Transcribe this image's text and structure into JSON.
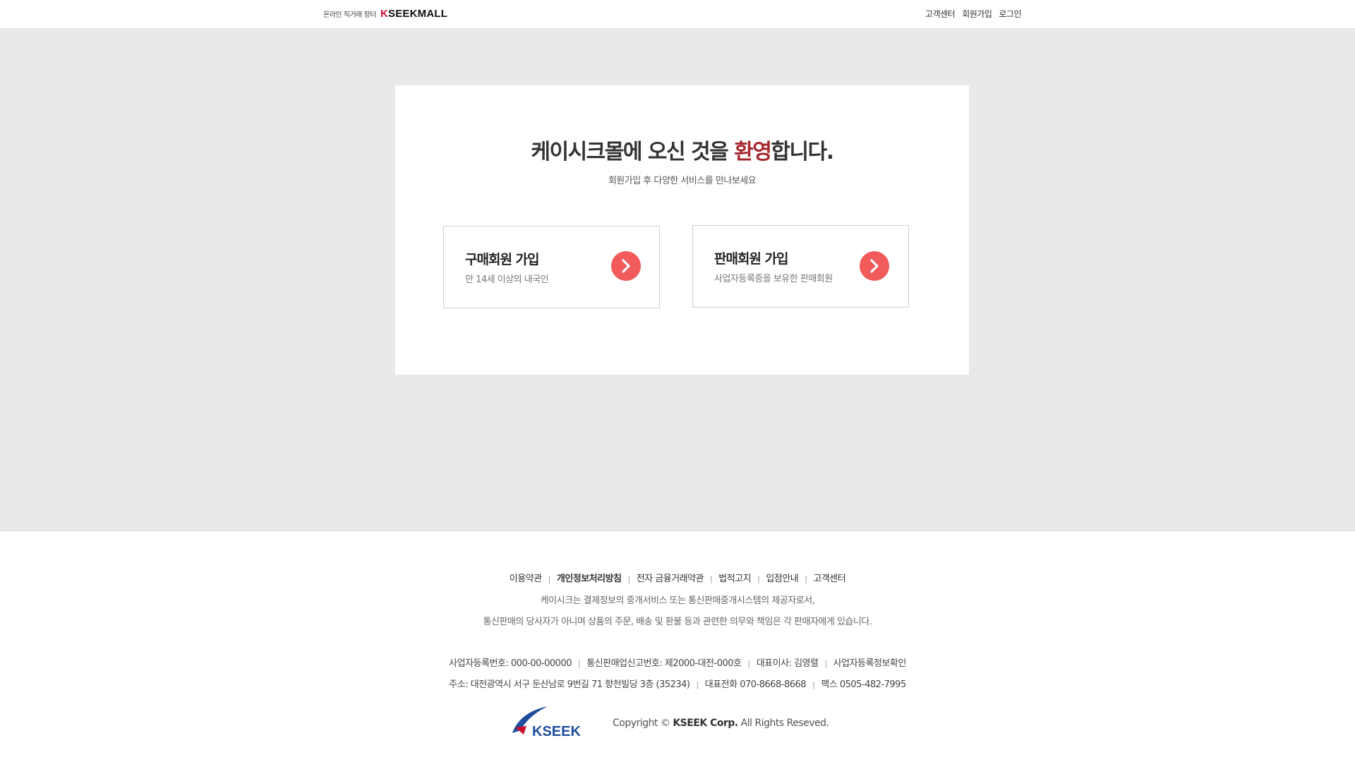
{
  "header": {
    "tagline": "온라인 직거래 장터",
    "logo_k": "K",
    "logo_rest": "SEEKMALL",
    "nav": {
      "customer_center": "고객센터",
      "signup": "회원가입",
      "login": "로그인"
    }
  },
  "welcome": {
    "title_before": "케이시크몰에 오신 것을 ",
    "title_accent": "환영",
    "title_after": "합니다.",
    "subtitle": "회원가입 후 다양한 서비스를 만나보세요",
    "buyer": {
      "title": "구매회원 가입",
      "desc": "만 14세 이상의 내국인"
    },
    "seller": {
      "title": "판매회원 가입",
      "desc": "사업자등록증을 보유한 판매회원"
    }
  },
  "footer": {
    "links": {
      "terms": "이용약관",
      "privacy": "개인정보처리방침",
      "efinance": "전자 금융거래약관",
      "legal": "법적고지",
      "store": "입점안내",
      "customer": "고객센터"
    },
    "note_line1": "케이시크는 결제정보의 중개서비스 또는 통신판매중개시스템의 제공자로서,",
    "note_line2": "통신판매의 당사자가 아니며 상품의 주문, 배송 및 환불 등과 관련한 의무와 책임은 각 판매자에게 있습니다.",
    "biz_reg": "사업자등록번호: 000-00-00000",
    "mail_order": "통신판매업신고번호:  제2000-대전-000호",
    "ceo": "대표이사: 김영렬",
    "biz_check": "사업자등록정보확인",
    "address": "주소: 대전광역시 서구 둔산남로 9번길 71  향천빌딩 3층  (35234)",
    "phone": "대표전화 070-8668-8668",
    "fax": "팩스  0505-482-7995",
    "corp_logo_text": "KSEEK",
    "copyright_pre": "Copyright © ",
    "copyright_company": "KSEEK  Corp.",
    "copyright_post": " All Rights Reseved."
  },
  "colors": {
    "accent": "#a5262d",
    "arrow_button": "#f15b5b",
    "background_gray": "#e9e9e9",
    "logo_blue": "#1f4e9c"
  }
}
